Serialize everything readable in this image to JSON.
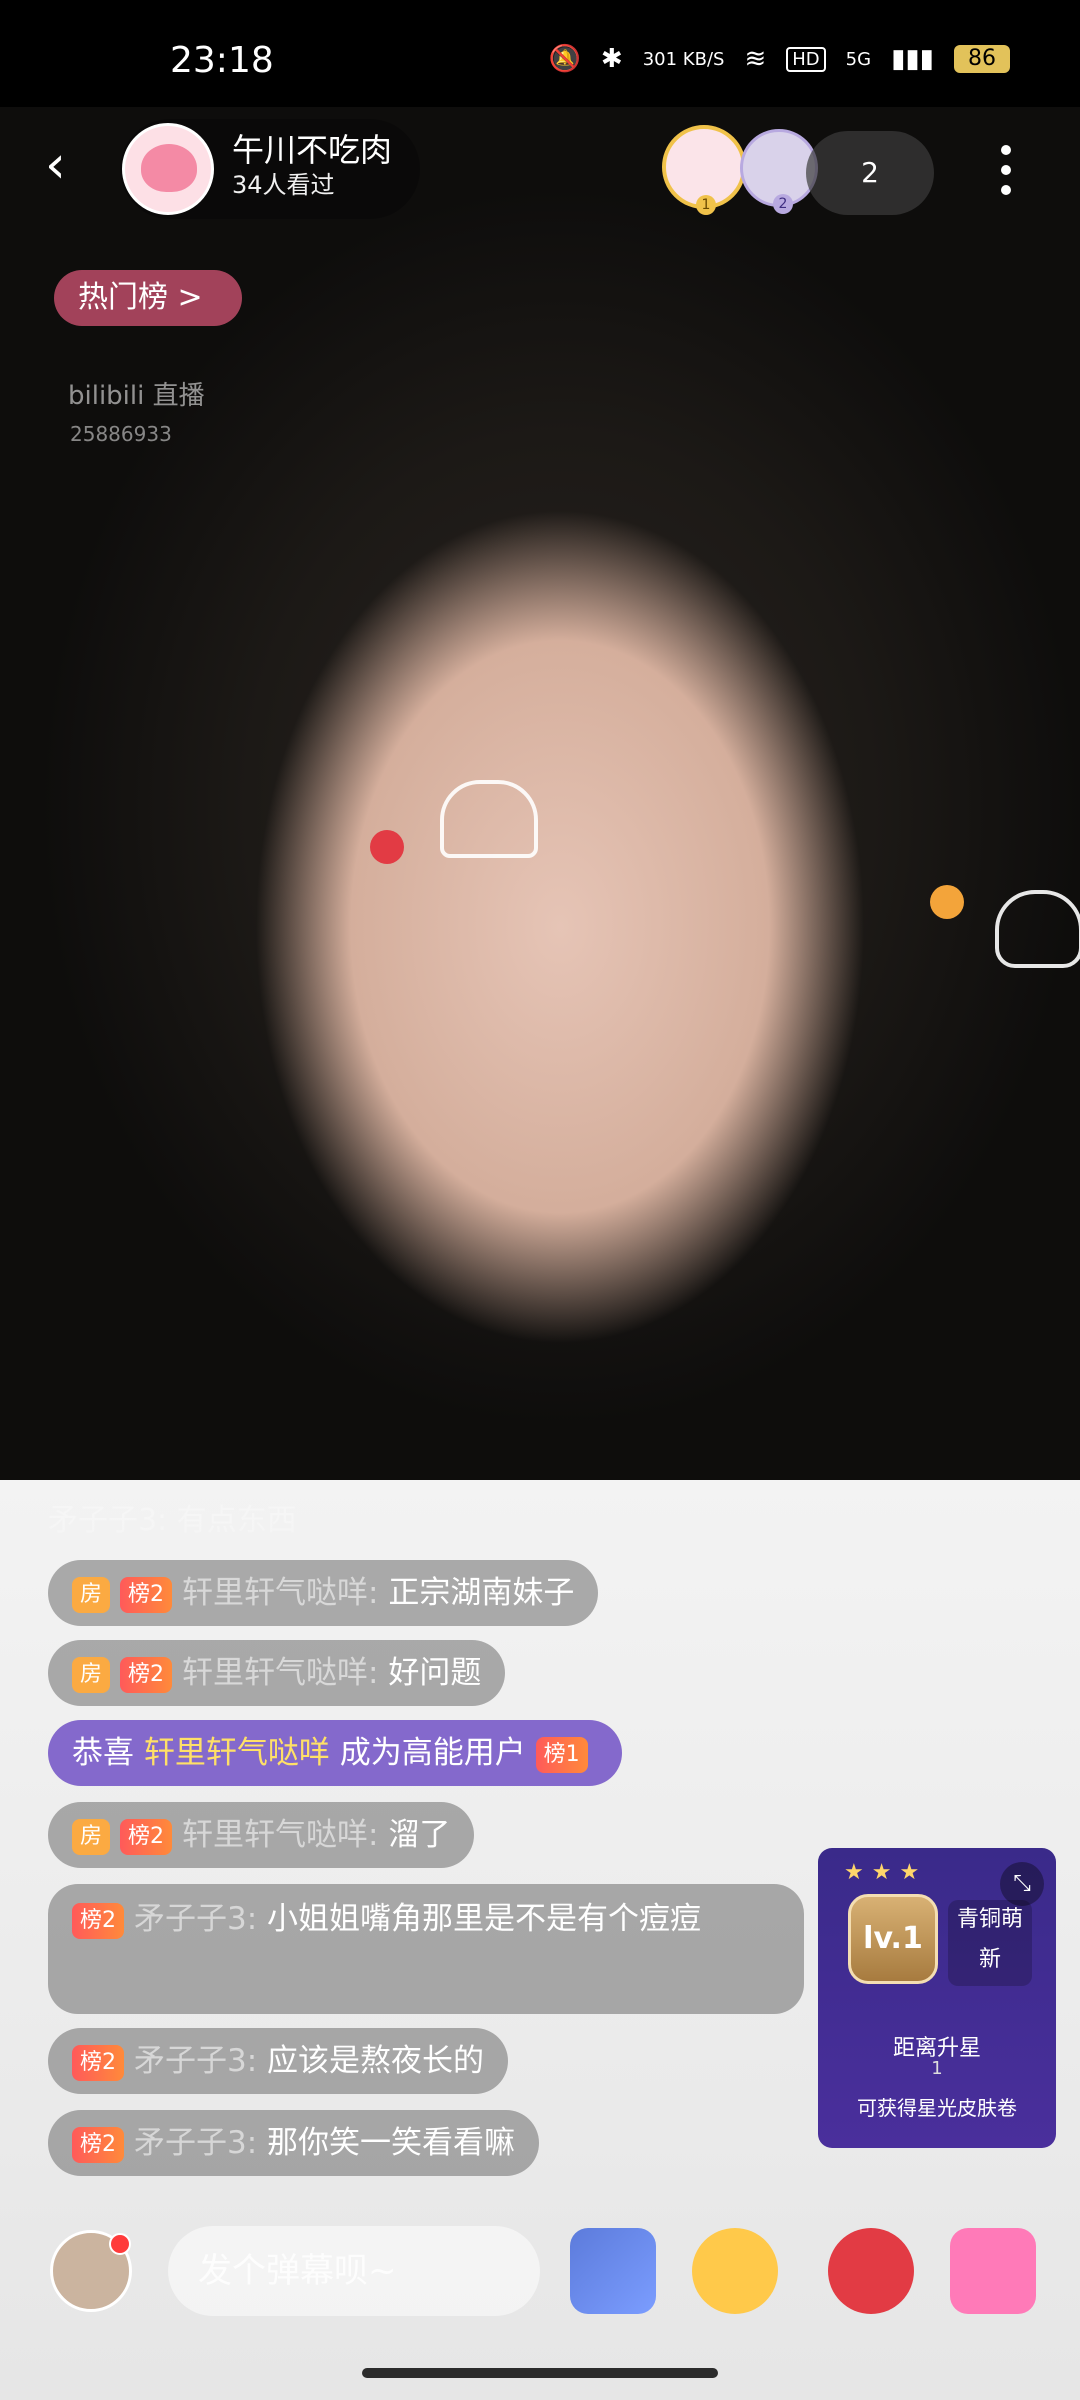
{
  "status_bar": {
    "time": "23:18",
    "network_speed": "301 KB/S",
    "signal_label": "5G",
    "hd_label": "HD",
    "battery": "86"
  },
  "header": {
    "host_name": "午川不吃肉",
    "viewers": "34人看过",
    "audience_count": "2"
  },
  "hot_list": {
    "label": "热门榜 >"
  },
  "watermark": {
    "brand": "bilibili 直播",
    "room_id": "25886933"
  },
  "chat": {
    "faded_line": "矛子子3: 有点东西",
    "messages": [
      {
        "room_tag": "房",
        "rank_tag": "榜2",
        "nick": "轩里轩气哒咩",
        "text": "正宗湖南妹子"
      },
      {
        "room_tag": "房",
        "rank_tag": "榜2",
        "nick": "轩里轩气哒咩",
        "text": "好问题"
      },
      {
        "prefix": "恭喜",
        "highlight": "轩里轩气哒咩",
        "suffix": "成为高能用户",
        "rank_tag": "榜1"
      },
      {
        "room_tag": "房",
        "rank_tag": "榜2",
        "nick": "轩里轩气哒咩",
        "text": "溜了"
      },
      {
        "rank_tag": "榜2",
        "nick": "矛子子3",
        "text": "小姐姐嘴角那里是不是有个痘痘"
      },
      {
        "rank_tag": "榜2",
        "nick": "矛子子3",
        "text": "应该是熬夜长的"
      },
      {
        "rank_tag": "榜2",
        "nick": "矛子子3",
        "text": "那你笑一笑看看嘛"
      }
    ]
  },
  "level_card": {
    "level": "lv.1",
    "tier": "青铜萌新",
    "upgrade_label": "距离升星",
    "upgrade_value": "1",
    "reward": "可获得星光皮肤卷"
  },
  "bottom_bar": {
    "input_placeholder": "发个弹幕呗~"
  }
}
